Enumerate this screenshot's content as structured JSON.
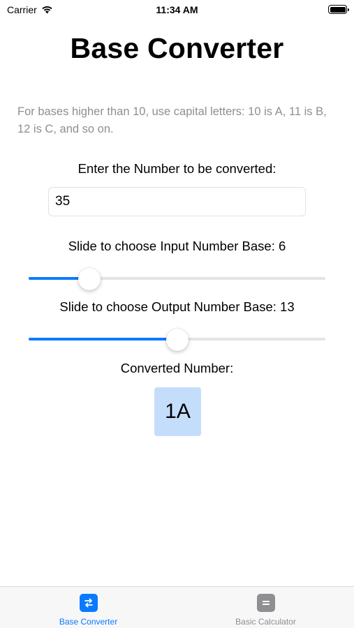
{
  "status_bar": {
    "carrier": "Carrier",
    "time": "11:34 AM"
  },
  "page": {
    "title": "Base Converter",
    "hint": "For bases higher than 10, use capital letters: 10 is A, 11 is B, 12 is C, and so on."
  },
  "number_input": {
    "label": "Enter the Number to be converted:",
    "value": "35"
  },
  "input_base": {
    "label": "Slide to choose Input Number Base: 6",
    "value": 6,
    "fill_fraction": 0.205
  },
  "output_base": {
    "label": "Slide to choose Output Number Base: 13",
    "value": 13,
    "fill_fraction": 0.502
  },
  "result": {
    "label": "Converted Number:",
    "value": "1A"
  },
  "tab_bar": {
    "tabs": [
      {
        "label": "Base Converter",
        "icon": "swap-arrows-icon",
        "active": true
      },
      {
        "label": "Basic Calculator",
        "icon": "equals-icon",
        "active": false
      }
    ]
  },
  "colors": {
    "accent": "#0a7aff",
    "result_background": "#c4ddfb",
    "hint_text": "#8e8e93",
    "inactive_tab": "#8e8e93"
  }
}
